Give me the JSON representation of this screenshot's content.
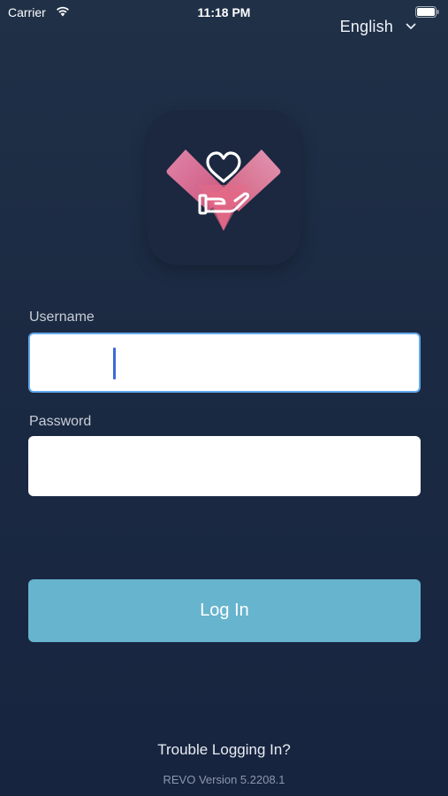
{
  "status_bar": {
    "carrier": "Carrier",
    "time": "11:18 PM"
  },
  "language": {
    "selected": "English"
  },
  "form": {
    "username_label": "Username",
    "username_value": "",
    "password_label": "Password",
    "password_value": ""
  },
  "actions": {
    "login_label": "Log In",
    "trouble_label": "Trouble Logging In?"
  },
  "footer": {
    "version": "REVO Version 5.2208.1"
  },
  "colors": {
    "background": "#1b2a42",
    "login_button": "#66b4cd",
    "focus_border": "#63a8ee",
    "logo_pink": "#ec7aa3"
  },
  "icons": [
    "wifi-icon",
    "battery-icon",
    "chevron-down-icon",
    "heart-hand-logo-icon"
  ]
}
